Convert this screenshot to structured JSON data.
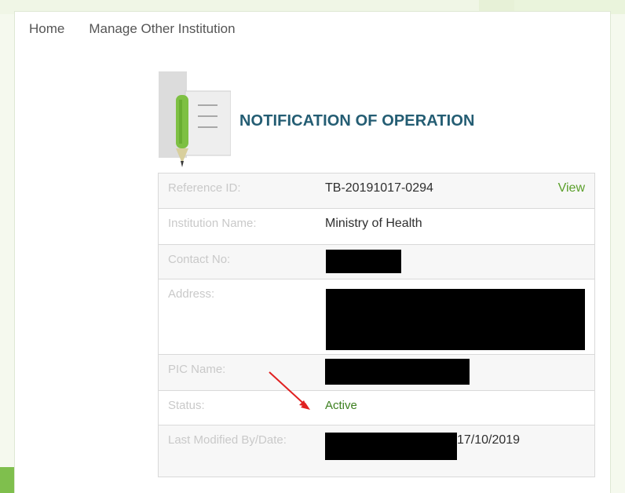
{
  "nav": {
    "home": "Home",
    "manage": "Manage Other Institution"
  },
  "page": {
    "title": "NOTIFICATION OF OPERATION"
  },
  "record": {
    "reference_label": "Reference ID:",
    "reference_value": "TB-20191017-0294",
    "view_label": "View",
    "institution_label": "Institution Name:",
    "institution_value": "Ministry of Health",
    "contact_label": "Contact No:",
    "address_label": "Address:",
    "pic_label": "PIC Name:",
    "status_label": "Status:",
    "status_value": "Active",
    "modified_label": "Last Modified By/Date:",
    "modified_date": "17/10/2019"
  },
  "colors": {
    "accent_green": "#5a9f2a",
    "title_blue": "#245d73",
    "annotation_red": "#e02020"
  },
  "icons": {
    "logo": "document-pencil-icon",
    "annotation": "red-arrow-annotation"
  }
}
